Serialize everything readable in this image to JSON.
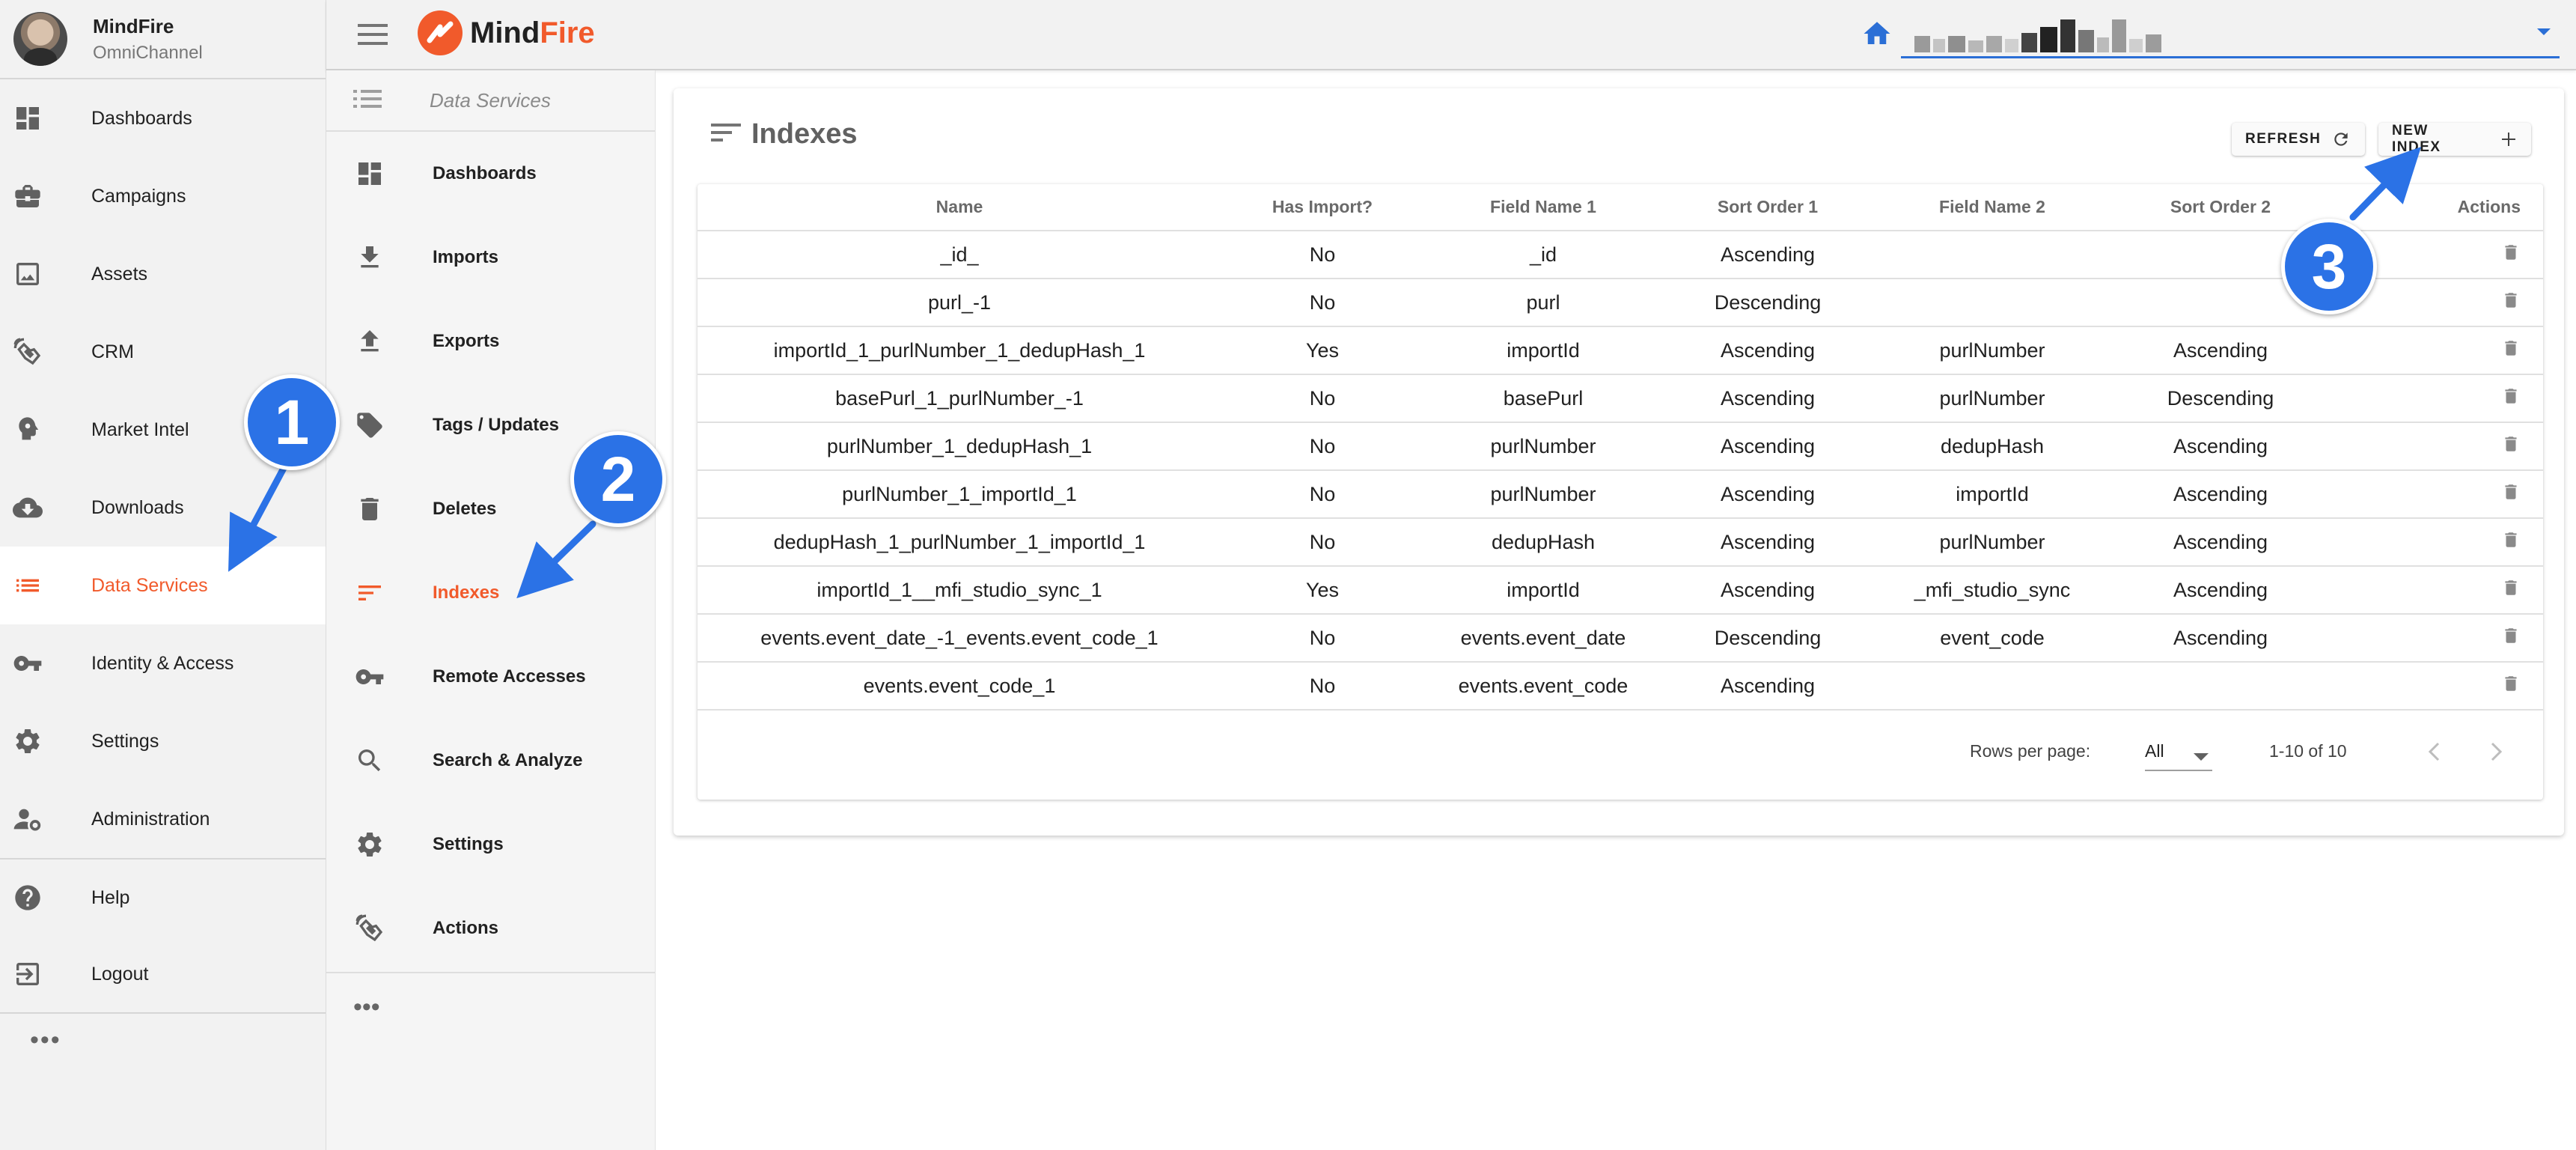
{
  "profile": {
    "name": "MindFire",
    "subtitle": "OmniChannel"
  },
  "sidebar": {
    "items": [
      {
        "label": "Dashboards",
        "icon": "dashboard-icon"
      },
      {
        "label": "Campaigns",
        "icon": "briefcase-icon"
      },
      {
        "label": "Assets",
        "icon": "image-icon"
      },
      {
        "label": "CRM",
        "icon": "signal-hand-icon"
      },
      {
        "label": "Market Intel",
        "icon": "brain-icon"
      },
      {
        "label": "Downloads",
        "icon": "cloud-download-icon"
      },
      {
        "label": "Data Services",
        "icon": "list-icon",
        "active": true
      },
      {
        "label": "Identity & Access",
        "icon": "key-icon"
      },
      {
        "label": "Settings",
        "icon": "gear-icon"
      },
      {
        "label": "Administration",
        "icon": "user-gear-icon"
      },
      {
        "label": "Help",
        "icon": "help-icon"
      },
      {
        "label": "Logout",
        "icon": "logout-icon"
      }
    ],
    "more": "•••"
  },
  "topbar": {
    "brand_prefix": "Mind",
    "brand_suffix": "Fire"
  },
  "subnav": {
    "header": "Data Services",
    "items": [
      {
        "label": "Dashboards",
        "icon": "dashboard-icon"
      },
      {
        "label": "Imports",
        "icon": "download-icon"
      },
      {
        "label": "Exports",
        "icon": "upload-icon"
      },
      {
        "label": "Tags / Updates",
        "icon": "tag-icon"
      },
      {
        "label": "Deletes",
        "icon": "trash-icon"
      },
      {
        "label": "Indexes",
        "icon": "sort-icon",
        "active": true
      },
      {
        "label": "Remote Accesses",
        "icon": "key-icon"
      },
      {
        "label": "Search & Analyze",
        "icon": "search-icon"
      },
      {
        "label": "Settings",
        "icon": "gear-icon"
      },
      {
        "label": "Actions",
        "icon": "signal-hand-icon"
      }
    ],
    "more": "•••"
  },
  "card": {
    "title": "Indexes",
    "refresh_label": "REFRESH",
    "new_index_label": "NEW INDEX"
  },
  "table": {
    "headers": [
      "Name",
      "Has Import?",
      "Field Name 1",
      "Sort Order 1",
      "Field Name 2",
      "Sort Order 2",
      "Actions"
    ],
    "rows": [
      [
        "_id_",
        "No",
        "_id",
        "Ascending",
        "",
        ""
      ],
      [
        "purl_-1",
        "No",
        "purl",
        "Descending",
        "",
        ""
      ],
      [
        "importId_1_purlNumber_1_dedupHash_1",
        "Yes",
        "importId",
        "Ascending",
        "purlNumber",
        "Ascending"
      ],
      [
        "basePurl_1_purlNumber_-1",
        "No",
        "basePurl",
        "Ascending",
        "purlNumber",
        "Descending"
      ],
      [
        "purlNumber_1_dedupHash_1",
        "No",
        "purlNumber",
        "Ascending",
        "dedupHash",
        "Ascending"
      ],
      [
        "purlNumber_1_importId_1",
        "No",
        "purlNumber",
        "Ascending",
        "importId",
        "Ascending"
      ],
      [
        "dedupHash_1_purlNumber_1_importId_1",
        "No",
        "dedupHash",
        "Ascending",
        "purlNumber",
        "Ascending"
      ],
      [
        "importId_1__mfi_studio_sync_1",
        "Yes",
        "importId",
        "Ascending",
        "_mfi_studio_sync",
        "Ascending"
      ],
      [
        "events.event_date_-1_events.event_code_1",
        "No",
        "events.event_date",
        "Descending",
        "event_code",
        "Ascending"
      ],
      [
        "events.event_code_1",
        "No",
        "events.event_code",
        "Ascending",
        "",
        ""
      ]
    ],
    "rows_per_page_label": "Rows per page:",
    "rows_per_page_value": "All",
    "range_label": "1-10 of 10"
  },
  "annotations": {
    "one": "1",
    "two": "2",
    "three": "3"
  },
  "colors": {
    "accent": "#f15a2b",
    "annotation": "#2b72e6",
    "select_underline": "#2b6fd6"
  }
}
